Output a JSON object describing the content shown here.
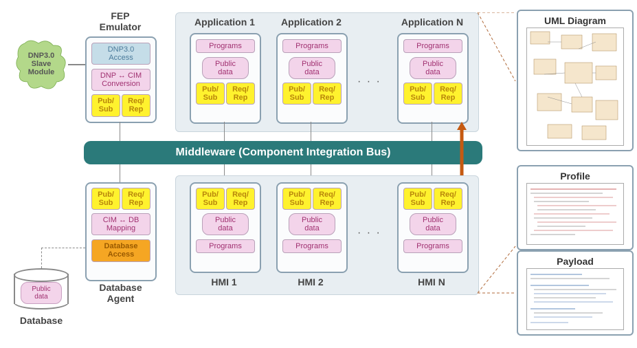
{
  "dnp_module": {
    "title": "DNP3.0\nSlave\nModule"
  },
  "fep": {
    "title": "FEP\nEmulator",
    "dnp_access": "DNP3.0\nAccess",
    "dnp_cim": "DNP ↔ CIM\nConversion",
    "pubsub": "Pub/\nSub",
    "reqrep": "Req/\nRep"
  },
  "apps_group_labels": {
    "app1": "Application 1",
    "app2": "Application 2",
    "appn": "Application N"
  },
  "app_block": {
    "programs": "Programs",
    "public_data": "Public\ndata",
    "pubsub": "Pub/\nSub",
    "reqrep": "Req/\nRep"
  },
  "middleware": "Middleware (Component Integration Bus)",
  "hmi_labels": {
    "h1": "HMI 1",
    "h2": "HMI 2",
    "hn": "HMI N"
  },
  "dbagent": {
    "title": "Database\nAgent",
    "pubsub": "Pub/\nSub",
    "reqrep": "Req/\nRep",
    "cimdb": "CIM ↔ DB\nMapping",
    "dbaccess": "Database\nAccess"
  },
  "database": {
    "title": "Database",
    "public_data": "Public\ndata"
  },
  "right": {
    "uml": "UML Diagram",
    "profile": "Profile",
    "payload": "Payload"
  },
  "ellipsis": "· · ·"
}
